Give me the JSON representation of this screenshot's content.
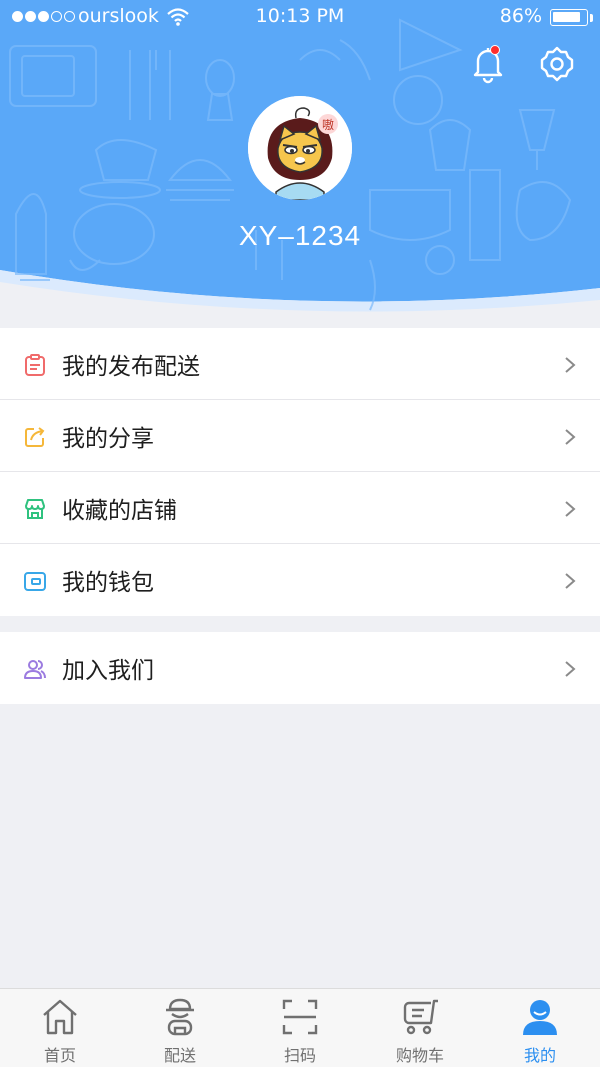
{
  "status_bar": {
    "carrier": "ourslook",
    "time": "10:13 PM",
    "battery": "86%",
    "battery_level": 0.86
  },
  "profile": {
    "username": "XY–1234",
    "has_notification": true
  },
  "menu": {
    "items": [
      {
        "label": "我的发布配送",
        "icon": "clipboard-icon",
        "color": "#f06b6b"
      },
      {
        "label": "我的分享",
        "icon": "share-icon",
        "color": "#f5b73a"
      },
      {
        "label": "收藏的店铺",
        "icon": "store-icon",
        "color": "#2fc27f"
      },
      {
        "label": "我的钱包",
        "icon": "wallet-icon",
        "color": "#38a7e8"
      }
    ],
    "join": {
      "label": "加入我们",
      "icon": "users-icon",
      "color": "#9b7be0"
    }
  },
  "tabbar": {
    "tabs": [
      {
        "label": "首页",
        "icon": "home-icon",
        "active": false
      },
      {
        "label": "配送",
        "icon": "courier-icon",
        "active": false
      },
      {
        "label": "扫码",
        "icon": "scan-icon",
        "active": false
      },
      {
        "label": "购物车",
        "icon": "cart-icon",
        "active": false
      },
      {
        "label": "我的",
        "icon": "profile-icon",
        "active": true
      }
    ]
  },
  "colors": {
    "header_blue": "#56a5f7",
    "accent": "#2c8ff0",
    "background": "#eff0f4"
  }
}
